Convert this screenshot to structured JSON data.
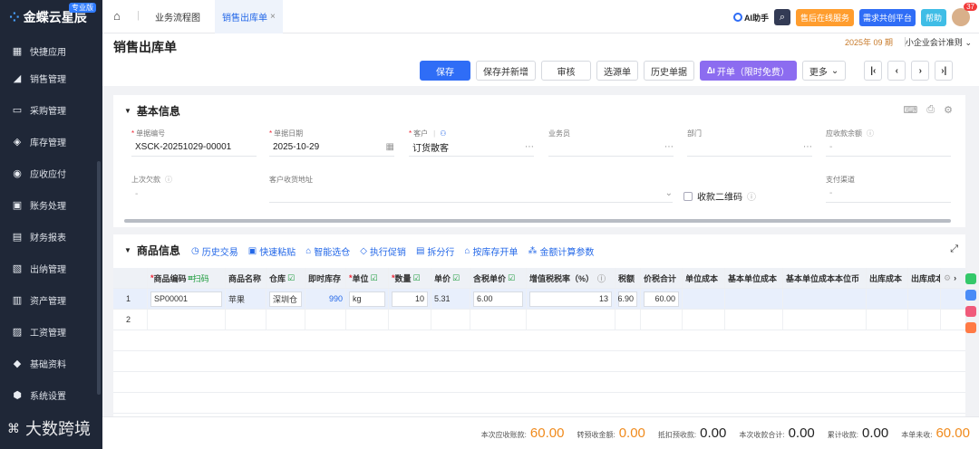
{
  "sidebar": {
    "brand": "金蝶云星辰",
    "edition_badge": "专业版",
    "items": [
      {
        "label": "快捷应用",
        "icon": "grid-icon"
      },
      {
        "label": "销售管理",
        "icon": "sales-icon"
      },
      {
        "label": "采购管理",
        "icon": "cart-icon"
      },
      {
        "label": "库存管理",
        "icon": "box-icon"
      },
      {
        "label": "应收应付",
        "icon": "money-icon"
      },
      {
        "label": "账务处理",
        "icon": "ledger-icon"
      },
      {
        "label": "财务报表",
        "icon": "report-icon"
      },
      {
        "label": "出纳管理",
        "icon": "cashier-icon"
      },
      {
        "label": "资产管理",
        "icon": "asset-icon"
      },
      {
        "label": "工资管理",
        "icon": "salary-icon"
      },
      {
        "label": "基础资料",
        "icon": "stack-icon"
      },
      {
        "label": "系统设置",
        "icon": "gear-icon"
      }
    ],
    "watermark": "大数跨境"
  },
  "topbar": {
    "tabs": [
      {
        "label": "业务流程图",
        "active": false
      },
      {
        "label": "销售出库单",
        "active": true
      }
    ],
    "ai_label": "AI助手",
    "after_sales": "售后在线服务",
    "demand_label": "需求共创平台",
    "help_label": "帮助",
    "notif_count": "37"
  },
  "page": {
    "title": "销售出库单",
    "period": "2025年 09 期",
    "ledger": "小企业会计准则"
  },
  "toolbar": {
    "save": "保存",
    "save_new": "保存并新增",
    "audit": "审核",
    "source": "选源单",
    "history": "历史单据",
    "invoice": "开单（限时免费）",
    "more": "更多"
  },
  "basic": {
    "title": "基本信息",
    "fields": {
      "bill_no": {
        "label": "单据编号",
        "value": "XSCK-20251029-00001"
      },
      "bill_date": {
        "label": "单据日期",
        "value": "2025-10-29"
      },
      "customer": {
        "label": "客户",
        "value": "订货散客"
      },
      "salesman": {
        "label": "业务员",
        "value": ""
      },
      "dept": {
        "label": "部门",
        "value": ""
      },
      "receivable": {
        "label": "应收款余额",
        "value": "-"
      },
      "last_owed": {
        "label": "上次欠款",
        "value": "-"
      },
      "address": {
        "label": "客户收货地址",
        "value": ""
      },
      "qr": {
        "label": "收款二维码"
      },
      "pay_channel": {
        "label": "支付渠道",
        "value": "-"
      }
    }
  },
  "goods": {
    "title": "商品信息",
    "actions": [
      "历史交易",
      "快速粘贴",
      "智能选仓",
      "执行促销",
      "拆分行",
      "按库存开单",
      "金额计算参数"
    ],
    "headers": [
      "商品编码",
      "扫码",
      "商品名称",
      "仓库",
      "即时库存",
      "单位",
      "数量",
      "单价",
      "含税单价",
      "增值税税率（%）",
      "税额",
      "价税合计",
      "单位成本",
      "基本单位成本",
      "基本单位成本本位币",
      "出库成本",
      "出库成本"
    ],
    "rows": [
      {
        "no": "1",
        "code": "SP00001",
        "name": "苹果",
        "warehouse": "深圳仓",
        "stock": "990",
        "unit": "kg",
        "qty": "10",
        "price": "5.31",
        "tax_price": "6.00",
        "tax_rate": "13",
        "tax": "6.90",
        "total": "60.00"
      },
      {
        "no": "2"
      }
    ]
  },
  "footer": {
    "items": [
      {
        "label": "本次应收账款:",
        "value": "60.00",
        "orange": true
      },
      {
        "label": "转预收金额:",
        "value": "0.00",
        "orange": true
      },
      {
        "label": "抵扣预收款:",
        "value": "0.00",
        "orange": false
      },
      {
        "label": "本次收款合计:",
        "value": "0.00",
        "orange": false
      },
      {
        "label": "累计收款:",
        "value": "0.00",
        "orange": false
      },
      {
        "label": "本单未收:",
        "value": "60.00",
        "orange": true
      }
    ]
  }
}
